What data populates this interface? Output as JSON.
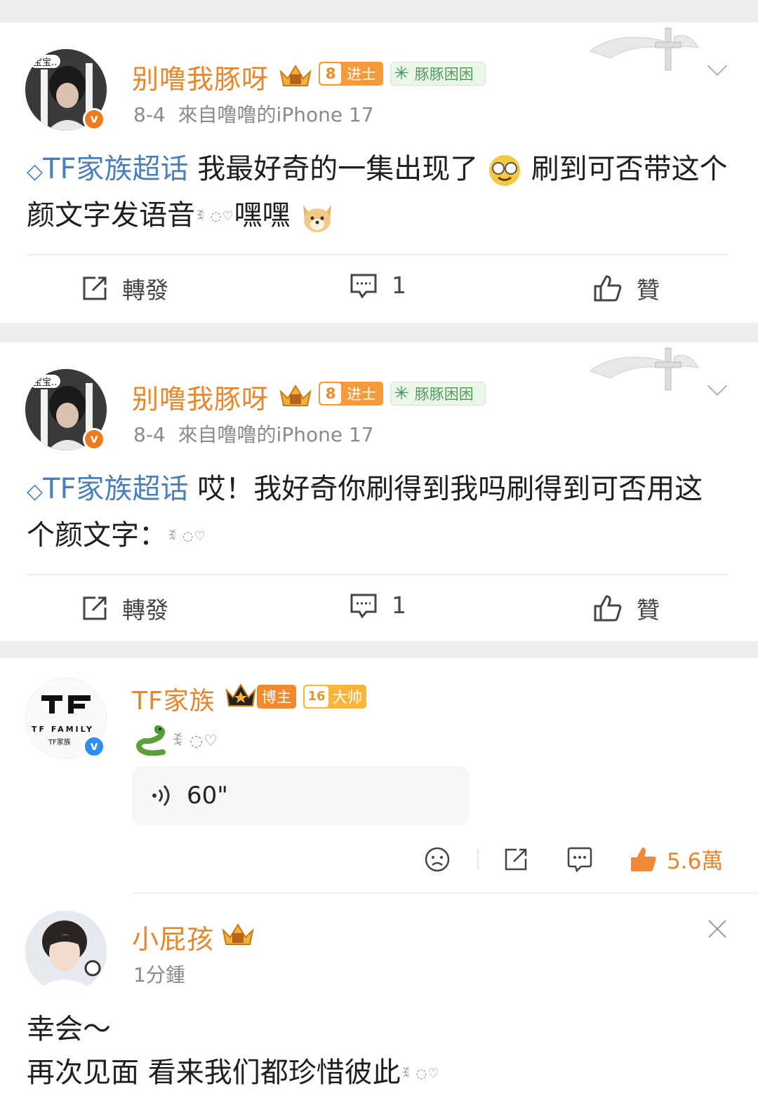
{
  "post1": {
    "username": "别噜我豚呀",
    "level": "8",
    "rank": "进士",
    "fan_badge": "豚豚困困",
    "date": "8-4",
    "source": "來自噜噜的iPhone 17",
    "topic": "TF家族超话",
    "text_a": "我最好奇的一集出现了",
    "text_b": "刷到可否带这个颜文字发语音",
    "text_c": "嘿嘿",
    "kaomoji": "ꉂ ◌♡",
    "repost_label": "轉發",
    "comment_count": "1",
    "like_label": "贊",
    "avatar_bubble": "宝宝.."
  },
  "post2": {
    "username": "别噜我豚呀",
    "level": "8",
    "rank": "进士",
    "fan_badge": "豚豚困困",
    "date": "8-4",
    "source": "來自噜噜的iPhone 17",
    "topic": "TF家族超话",
    "text_a": "哎！我好奇你刷得到我吗刷得到可否用这个颜文字：",
    "kaomoji": "ꉂ ◌♡",
    "repost_label": "轉發",
    "comment_count": "1",
    "like_label": "贊",
    "avatar_bubble": "宝宝.."
  },
  "post3": {
    "username": "TF家族",
    "badge_blogger": "博主",
    "level": "16",
    "rank": "大帅",
    "kaomoji": "ꉂ ◌♡",
    "voice_duration": "60\"",
    "like_count": "5.6萬",
    "logo_family": "TF FAMILY",
    "logo_cn": "TF家族"
  },
  "post4": {
    "username": "小屁孩",
    "time": "1分鍾",
    "line1": "幸会～",
    "line2": "再次见面 看来我们都珍惜彼此",
    "kaomoji": "ꉂ ◌♡"
  },
  "colors": {
    "username": "#e8862d",
    "topic": "#4a7fb8",
    "level_tag": "#f59a3a",
    "fan_tag_bg": "#eaf6ea",
    "fan_tag_text": "#5a9a5a",
    "verified_orange": "#f07b1d",
    "verified_blue": "#2f8ef0",
    "like_active": "#f08a3a"
  },
  "icons": [
    "crown-icon",
    "diamond-topic-icon",
    "snowflake-icon",
    "repost-icon",
    "comment-icon",
    "like-icon",
    "chevron-down-icon",
    "close-icon",
    "sad-face-icon",
    "share-icon",
    "voice-icon",
    "nerd-emoji-icon",
    "dog-emoji-icon",
    "snake-emoji-icon",
    "angel-cross-decoration"
  ]
}
